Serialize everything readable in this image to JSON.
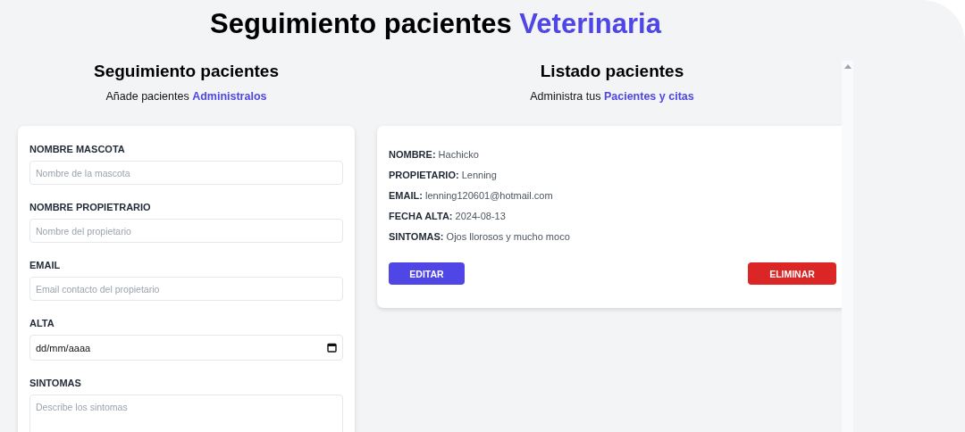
{
  "page_title": {
    "text": "Seguimiento pacientes",
    "highlight": "Veterinaria"
  },
  "form_section": {
    "heading": "Seguimiento pacientes",
    "subtitle": {
      "text": "Añade pacientes",
      "highlight": "Administralos"
    },
    "fields": [
      {
        "label": "NOMBRE MASCOTA",
        "kind": "text",
        "placeholder": "Nombre de la mascota"
      },
      {
        "label": "NOMBRE PROPIETRARIO",
        "kind": "text",
        "placeholder": "Nombre del propietario"
      },
      {
        "label": "EMAIL",
        "kind": "text",
        "placeholder": "Email contacto del propietario"
      },
      {
        "label": "ALTA",
        "kind": "date",
        "placeholder": "dd/mm/aaaa"
      },
      {
        "label": "SINTOMAS",
        "kind": "textarea",
        "placeholder": "Describe los sintomas"
      }
    ]
  },
  "list_section": {
    "heading": "Listado pacientes",
    "subtitle": {
      "text": "Administra tus",
      "highlight": "Pacientes y citas"
    },
    "patients": [
      {
        "details": [
          {
            "label": "NOMBRE:",
            "value": "Hachicko"
          },
          {
            "label": "PROPIETARIO:",
            "value": "Lenning"
          },
          {
            "label": "EMAIL:",
            "value": "lenning120601@hotmail.com"
          },
          {
            "label": "FECHA ALTA:",
            "value": "2024-08-13"
          },
          {
            "label": "SINTOMAS:",
            "value": "Ojos llorosos y mucho moco"
          }
        ],
        "buttons": [
          {
            "label": "EDITAR",
            "kind": "edit"
          },
          {
            "label": "ELIMINAR",
            "kind": "delete"
          }
        ]
      }
    ]
  }
}
